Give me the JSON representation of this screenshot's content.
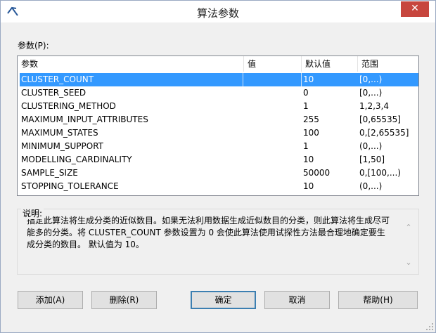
{
  "window": {
    "title": "算法参数"
  },
  "params_label": "参数(P):",
  "columns": {
    "param": "参数",
    "value": "值",
    "default": "默认值",
    "range": "范围"
  },
  "rows": [
    {
      "name": "CLUSTER_COUNT",
      "value": "",
      "default": "10",
      "range": "[0,...)",
      "selected": true
    },
    {
      "name": "CLUSTER_SEED",
      "value": "",
      "default": "0",
      "range": "[0,...)"
    },
    {
      "name": "CLUSTERING_METHOD",
      "value": "",
      "default": "1",
      "range": "1,2,3,4"
    },
    {
      "name": "MAXIMUM_INPUT_ATTRIBUTES",
      "value": "",
      "default": "255",
      "range": "[0,65535]"
    },
    {
      "name": "MAXIMUM_STATES",
      "value": "",
      "default": "100",
      "range": "0,[2,65535]"
    },
    {
      "name": "MINIMUM_SUPPORT",
      "value": "",
      "default": "1",
      "range": "(0,...)"
    },
    {
      "name": "MODELLING_CARDINALITY",
      "value": "",
      "default": "10",
      "range": "[1,50]"
    },
    {
      "name": "SAMPLE_SIZE",
      "value": "",
      "default": "50000",
      "range": "0,[100,...)"
    },
    {
      "name": "STOPPING_TOLERANCE",
      "value": "",
      "default": "10",
      "range": "(0,...)"
    }
  ],
  "description": {
    "label": "说明:",
    "lines": [
      "指定此算法将生成分类的近似数目。如果无法利用数据生成近似数目的分类，则此算法将生成尽可",
      "能多的分类。将 CLUSTER_COUNT 参数设置为 0 会使此算法使用试探性方法最合理地确定要生",
      "成分类的数目。      默认值为 10。"
    ]
  },
  "buttons": {
    "add": "添加(A)",
    "delete": "删除(R)",
    "ok": "确定",
    "cancel": "取消",
    "help": "帮助(H)"
  },
  "icons": {
    "app": "pickaxe-icon",
    "close": "close-icon",
    "scroll_up": "chevron-up-icon",
    "scroll_down": "chevron-down-icon"
  },
  "colors": {
    "selection": "#3399ff",
    "close_button": "#c7463e"
  }
}
